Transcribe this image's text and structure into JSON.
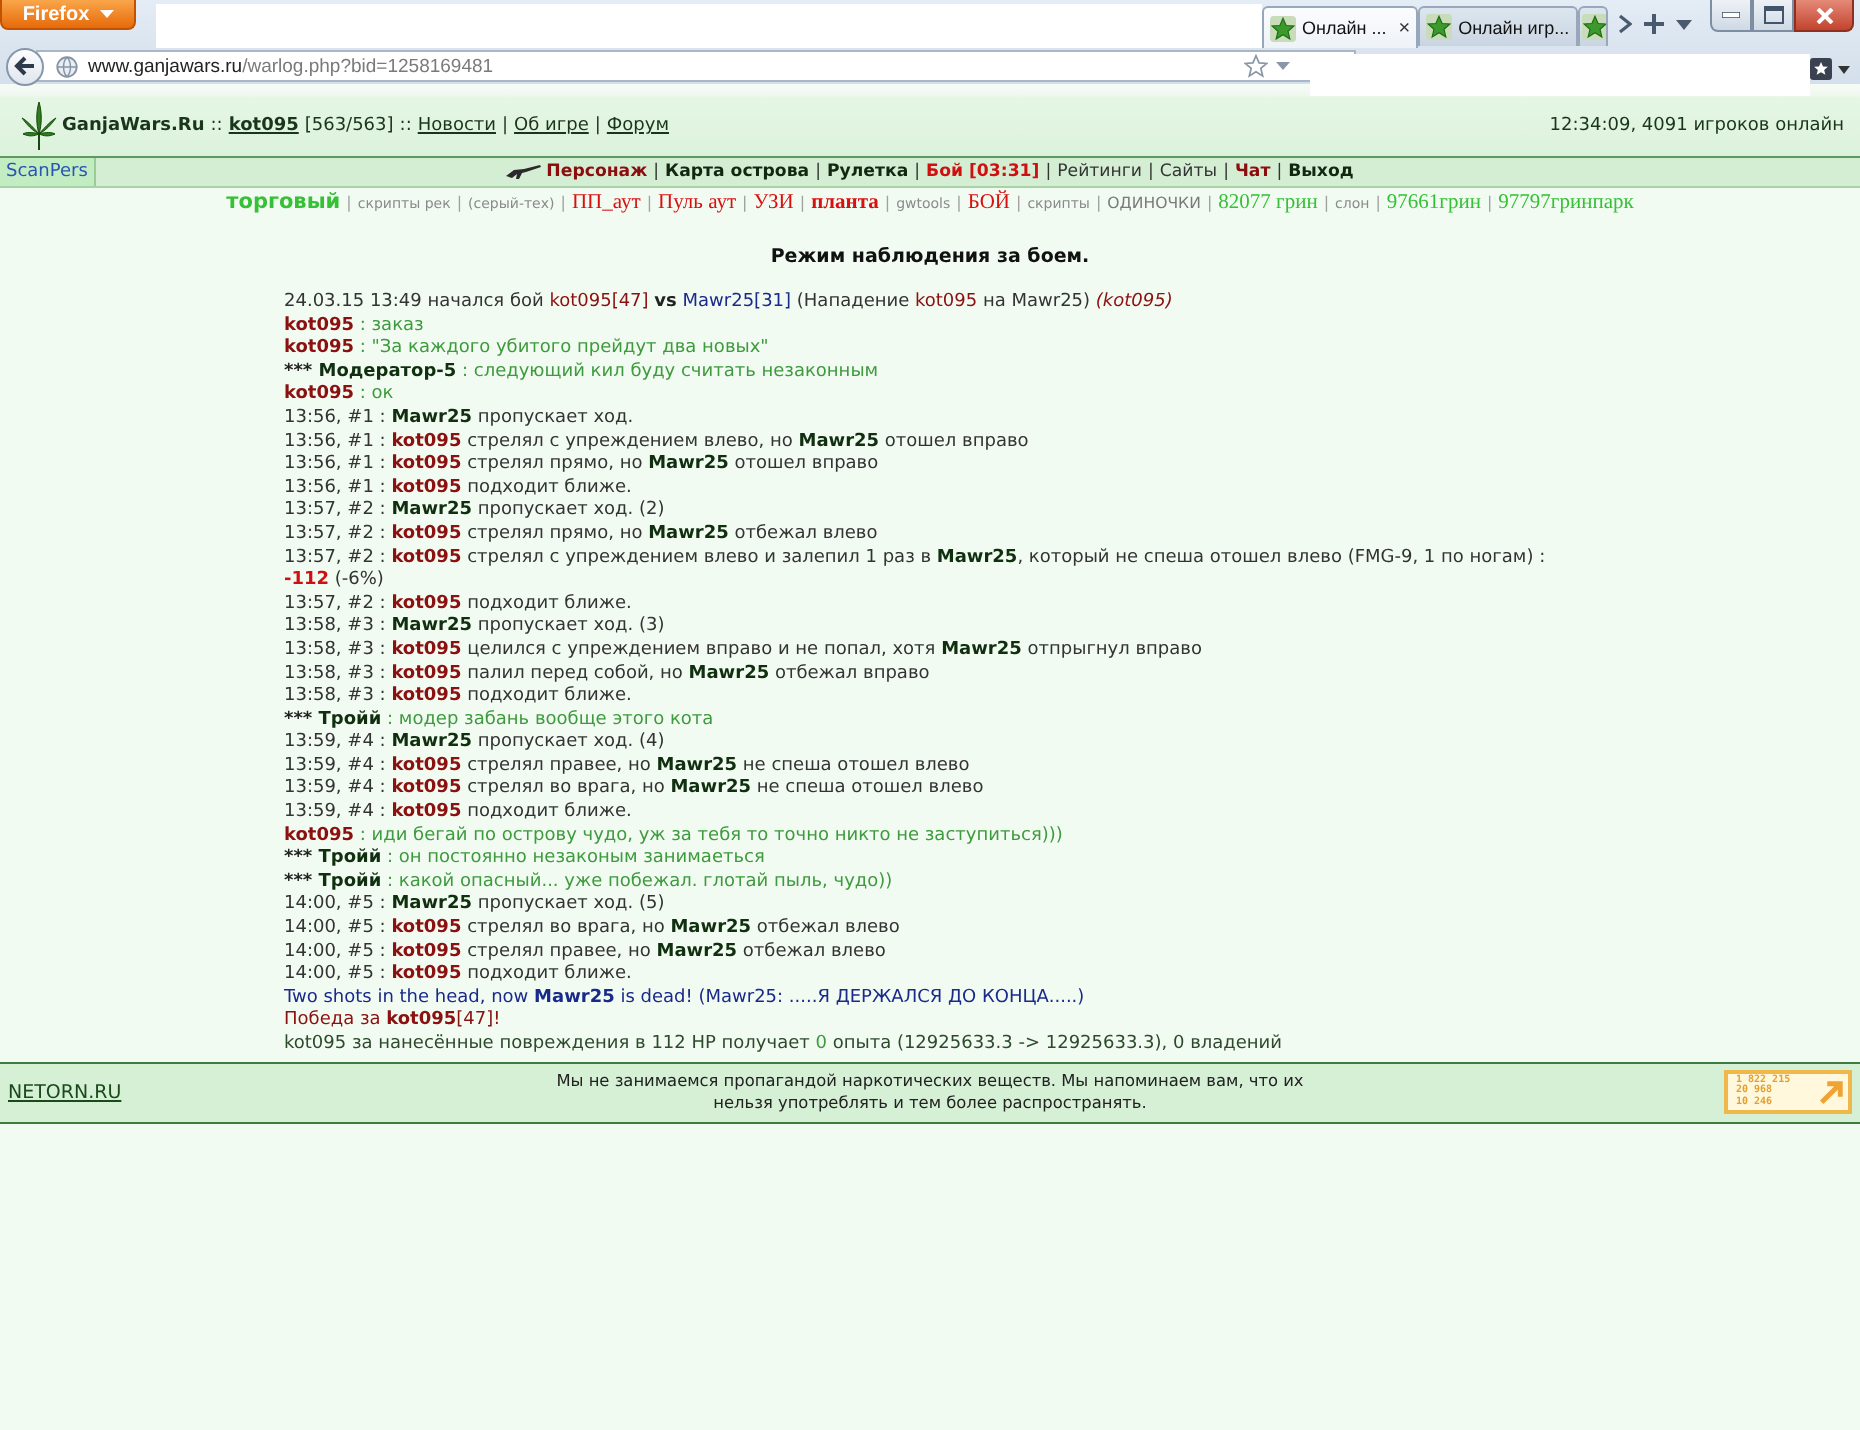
{
  "browser": {
    "menu_button": "Firefox",
    "tabs": [
      {
        "label": "Онлайн ...",
        "selected": true,
        "close": "×"
      },
      {
        "label": "Онлайн игр...",
        "selected": false
      },
      {
        "selected": false
      }
    ],
    "address": {
      "host": "www.ganjawars.ru",
      "path": "/warlog.php?bid=1258169481"
    }
  },
  "header": {
    "items": [
      {
        "kind": "brand",
        "text": "GanjaWars.Ru"
      },
      {
        "kind": "sep",
        "text": "::"
      },
      {
        "kind": "user",
        "text": "kot095"
      },
      {
        "kind": "plain",
        "text": "[563/563]"
      },
      {
        "kind": "sep",
        "text": "::"
      },
      {
        "kind": "link",
        "text": "Новости"
      },
      {
        "kind": "sep",
        "text": "|"
      },
      {
        "kind": "link",
        "text": "Об игре"
      },
      {
        "kind": "sep",
        "text": "|"
      },
      {
        "kind": "link",
        "text": "Форум"
      }
    ],
    "status": "12:34:09, 4091 игроков онлайн"
  },
  "nav": {
    "side_link": "ScanPers",
    "items": [
      {
        "kind": "accent",
        "text": "Персонаж",
        "icon": true
      },
      {
        "kind": "sep",
        "text": "|"
      },
      {
        "kind": "strong",
        "text": "Карта острова"
      },
      {
        "kind": "sep",
        "text": "|"
      },
      {
        "kind": "strong",
        "text": "Рулетка"
      },
      {
        "kind": "sep",
        "text": "|"
      },
      {
        "kind": "alert",
        "text": "Бой [03:31]"
      },
      {
        "kind": "sep",
        "text": "|"
      },
      {
        "kind": "normal",
        "text": "Рейтинги"
      },
      {
        "kind": "sep",
        "text": "|"
      },
      {
        "kind": "normal",
        "text": "Сайты"
      },
      {
        "kind": "sep",
        "text": "|"
      },
      {
        "kind": "accent",
        "text": "Чат"
      },
      {
        "kind": "sep",
        "text": "|"
      },
      {
        "kind": "strong",
        "text": "Выход"
      }
    ]
  },
  "scripts": [
    {
      "kind": "feature",
      "text": "торговый"
    },
    {
      "kind": "sep",
      "text": "|"
    },
    {
      "kind": "small",
      "text": "скрипты рек"
    },
    {
      "kind": "sep",
      "text": "|"
    },
    {
      "kind": "small",
      "text": "(серый-тех)"
    },
    {
      "kind": "sep",
      "text": "|"
    },
    {
      "kind": "serif",
      "text": "ПП_аут"
    },
    {
      "kind": "sep",
      "text": "|"
    },
    {
      "kind": "serif",
      "text": "Пуль аут"
    },
    {
      "kind": "sep",
      "text": "|"
    },
    {
      "kind": "serif",
      "text": "УЗИ"
    },
    {
      "kind": "sep",
      "text": "|"
    },
    {
      "kind": "serif-bold",
      "text": "планта"
    },
    {
      "kind": "sep",
      "text": "|"
    },
    {
      "kind": "small",
      "text": "gwtools"
    },
    {
      "kind": "sep",
      "text": "|"
    },
    {
      "kind": "serif",
      "text": "БОЙ"
    },
    {
      "kind": "sep",
      "text": "|"
    },
    {
      "kind": "small",
      "text": "скрипты"
    },
    {
      "kind": "sep",
      "text": "|"
    },
    {
      "kind": "caps",
      "text": "ОДИНОЧКИ"
    },
    {
      "kind": "sep",
      "text": "|"
    },
    {
      "kind": "green",
      "text": "82077 грин"
    },
    {
      "kind": "sep",
      "text": "|"
    },
    {
      "kind": "small",
      "text": "слон"
    },
    {
      "kind": "sep",
      "text": "|"
    },
    {
      "kind": "green",
      "text": "97661грин"
    },
    {
      "kind": "sep",
      "text": "|"
    },
    {
      "kind": "green",
      "text": "97797гринпарк"
    }
  ],
  "battle": {
    "title": "Режим наблюдения за боем.",
    "log": [
      [
        {
          "kind": "plain",
          "text": "24.03.15 13:49 начался бой "
        },
        {
          "kind": "tag",
          "text": "kot095[47] "
        },
        {
          "kind": "strong",
          "text": "vs"
        },
        {
          "kind": "blue-tag",
          "text": " Mawr25[31]"
        },
        {
          "kind": "plain",
          "text": " (Нападение "
        },
        {
          "kind": "tag",
          "text": "kot095"
        },
        {
          "kind": "plain",
          "text": " на Mawr25) "
        },
        {
          "kind": "note",
          "text": "(kot095)"
        }
      ],
      [
        {
          "kind": "red-name",
          "text": "kot095"
        },
        {
          "kind": "chat",
          "text": " : заказ"
        }
      ],
      [
        {
          "kind": "red-name",
          "text": "kot095"
        },
        {
          "kind": "chat",
          "text": " : \"За каждого убитого прейдут два новых\""
        }
      ],
      [
        {
          "kind": "strong",
          "text": "*** "
        },
        {
          "kind": "name",
          "text": "Модератор-5"
        },
        {
          "kind": "chat",
          "text": " : следующий кил буду считать незаконным"
        }
      ],
      [
        {
          "kind": "red-name",
          "text": "kot095"
        },
        {
          "kind": "chat",
          "text": " : ок"
        }
      ],
      [
        {
          "kind": "plain",
          "text": "13:56, #1 : "
        },
        {
          "kind": "name",
          "text": "Mawr25"
        },
        {
          "kind": "plain",
          "text": " пропускает ход."
        }
      ],
      [
        {
          "kind": "plain",
          "text": "13:56, #1 : "
        },
        {
          "kind": "red-name",
          "text": "kot095"
        },
        {
          "kind": "plain",
          "text": " стрелял с упреждением влево, но "
        },
        {
          "kind": "name",
          "text": "Mawr25"
        },
        {
          "kind": "plain",
          "text": " отошел вправо"
        }
      ],
      [
        {
          "kind": "plain",
          "text": "13:56, #1 : "
        },
        {
          "kind": "red-name",
          "text": "kot095"
        },
        {
          "kind": "plain",
          "text": " стрелял прямо, но "
        },
        {
          "kind": "name",
          "text": "Mawr25"
        },
        {
          "kind": "plain",
          "text": " отошел вправо"
        }
      ],
      [
        {
          "kind": "plain",
          "text": "13:56, #1 : "
        },
        {
          "kind": "red-name",
          "text": "kot095"
        },
        {
          "kind": "plain",
          "text": " подходит ближе."
        }
      ],
      [
        {
          "kind": "plain",
          "text": "13:57, #2 : "
        },
        {
          "kind": "name",
          "text": "Mawr25"
        },
        {
          "kind": "plain",
          "text": " пропускает ход. (2)"
        }
      ],
      [
        {
          "kind": "plain",
          "text": "13:57, #2 : "
        },
        {
          "kind": "red-name",
          "text": "kot095"
        },
        {
          "kind": "plain",
          "text": " стрелял прямо, но "
        },
        {
          "kind": "name",
          "text": "Mawr25"
        },
        {
          "kind": "plain",
          "text": " отбежал влево"
        }
      ],
      [
        {
          "kind": "plain",
          "text": "13:57, #2 : "
        },
        {
          "kind": "red-name",
          "text": "kot095"
        },
        {
          "kind": "plain",
          "text": " стрелял с упреждением влево и залепил 1 раз в "
        },
        {
          "kind": "name",
          "text": "Mawr25"
        },
        {
          "kind": "plain",
          "text": ", который не спеша отошел влево (FMG-9, 1 по ногам) :"
        }
      ],
      [
        {
          "kind": "damage",
          "text": "-112"
        },
        {
          "kind": "plain",
          "text": " (-6%)"
        }
      ],
      [
        {
          "kind": "plain",
          "text": "13:57, #2 : "
        },
        {
          "kind": "red-name",
          "text": "kot095"
        },
        {
          "kind": "plain",
          "text": " подходит ближе."
        }
      ],
      [
        {
          "kind": "plain",
          "text": "13:58, #3 : "
        },
        {
          "kind": "name",
          "text": "Mawr25"
        },
        {
          "kind": "plain",
          "text": " пропускает ход. (3)"
        }
      ],
      [
        {
          "kind": "plain",
          "text": "13:58, #3 : "
        },
        {
          "kind": "red-name",
          "text": "kot095"
        },
        {
          "kind": "plain",
          "text": " целился с упреждением вправо и не попал, хотя "
        },
        {
          "kind": "name",
          "text": "Mawr25"
        },
        {
          "kind": "plain",
          "text": " отпрыгнул вправо"
        }
      ],
      [
        {
          "kind": "plain",
          "text": "13:58, #3 : "
        },
        {
          "kind": "red-name",
          "text": "kot095"
        },
        {
          "kind": "plain",
          "text": " палил перед собой, но "
        },
        {
          "kind": "name",
          "text": "Mawr25"
        },
        {
          "kind": "plain",
          "text": " отбежал вправо"
        }
      ],
      [
        {
          "kind": "plain",
          "text": "13:58, #3 : "
        },
        {
          "kind": "red-name",
          "text": "kot095"
        },
        {
          "kind": "plain",
          "text": " подходит ближе."
        }
      ],
      [
        {
          "kind": "strong",
          "text": "*** "
        },
        {
          "kind": "name",
          "text": "Тройй"
        },
        {
          "kind": "chat",
          "text": " : модер забань вообще этого кота"
        }
      ],
      [
        {
          "kind": "plain",
          "text": "13:59, #4 : "
        },
        {
          "kind": "name",
          "text": "Mawr25"
        },
        {
          "kind": "plain",
          "text": " пропускает ход. (4)"
        }
      ],
      [
        {
          "kind": "plain",
          "text": "13:59, #4 : "
        },
        {
          "kind": "red-name",
          "text": "kot095"
        },
        {
          "kind": "plain",
          "text": " стрелял правее, но "
        },
        {
          "kind": "name",
          "text": "Mawr25"
        },
        {
          "kind": "plain",
          "text": " не спеша отошел влево"
        }
      ],
      [
        {
          "kind": "plain",
          "text": "13:59, #4 : "
        },
        {
          "kind": "red-name",
          "text": "kot095"
        },
        {
          "kind": "plain",
          "text": " стрелял во врага, но "
        },
        {
          "kind": "name",
          "text": "Mawr25"
        },
        {
          "kind": "plain",
          "text": " не спеша отошел влево"
        }
      ],
      [
        {
          "kind": "plain",
          "text": "13:59, #4 : "
        },
        {
          "kind": "red-name",
          "text": "kot095"
        },
        {
          "kind": "plain",
          "text": " подходит ближе."
        }
      ],
      [
        {
          "kind": "red-name",
          "text": "kot095"
        },
        {
          "kind": "chat",
          "text": " : иди бегай по острову чудо, уж за тебя то точно никто не заступиться)))"
        }
      ],
      [
        {
          "kind": "strong",
          "text": "*** "
        },
        {
          "kind": "name",
          "text": "Тройй"
        },
        {
          "kind": "chat",
          "text": " : он постоянно незаконым занимаеться"
        }
      ],
      [
        {
          "kind": "strong",
          "text": "*** "
        },
        {
          "kind": "name",
          "text": "Тройй"
        },
        {
          "kind": "chat",
          "text": " : какой опасный... уже побежал. глотай пыль, чудо))"
        }
      ],
      [
        {
          "kind": "plain",
          "text": "14:00, #5 : "
        },
        {
          "kind": "name",
          "text": "Mawr25"
        },
        {
          "kind": "plain",
          "text": " пропускает ход. (5)"
        }
      ],
      [
        {
          "kind": "plain",
          "text": "14:00, #5 : "
        },
        {
          "kind": "red-name",
          "text": "kot095"
        },
        {
          "kind": "plain",
          "text": " стрелял во врага, но "
        },
        {
          "kind": "name",
          "text": "Mawr25"
        },
        {
          "kind": "plain",
          "text": " отбежал влево"
        }
      ],
      [
        {
          "kind": "plain",
          "text": "14:00, #5 : "
        },
        {
          "kind": "red-name",
          "text": "kot095"
        },
        {
          "kind": "plain",
          "text": " стрелял правее, но "
        },
        {
          "kind": "name",
          "text": "Mawr25"
        },
        {
          "kind": "plain",
          "text": " отбежал влево"
        }
      ],
      [
        {
          "kind": "plain",
          "text": "14:00, #5 : "
        },
        {
          "kind": "red-name",
          "text": "kot095"
        },
        {
          "kind": "plain",
          "text": " подходит ближе."
        }
      ],
      [
        {
          "kind": "system",
          "text": "Two shots in the head, now "
        },
        {
          "kind": "system-name",
          "text": "Mawr25"
        },
        {
          "kind": "system",
          "text": " is dead! (Mawr25: .....Я ДЕРЖАЛСЯ ДО КОНЦА.....)"
        }
      ],
      [
        {
          "kind": "victory",
          "text": "Победа за "
        },
        {
          "kind": "red-name",
          "text": "kot095"
        },
        {
          "kind": "victory",
          "text": "[47]!"
        }
      ],
      [
        {
          "kind": "summary",
          "text": "kot095 за нанесённые повреждения в 112 HP получает "
        },
        {
          "kind": "gain",
          "text": "0"
        },
        {
          "kind": "summary",
          "text": " опыта (12925633.3 -> 12925633.3), 0 владений"
        }
      ]
    ]
  },
  "footer": {
    "link": "NETORN.RU",
    "notice_lines": [
      "Мы не занимаемся пропагандой наркотических веществ. Мы напоминаем вам, что их",
      "нельзя употреблять и тем более распространять."
    ],
    "counter": [
      "1 822 215",
      "20 968",
      "10 246"
    ]
  }
}
